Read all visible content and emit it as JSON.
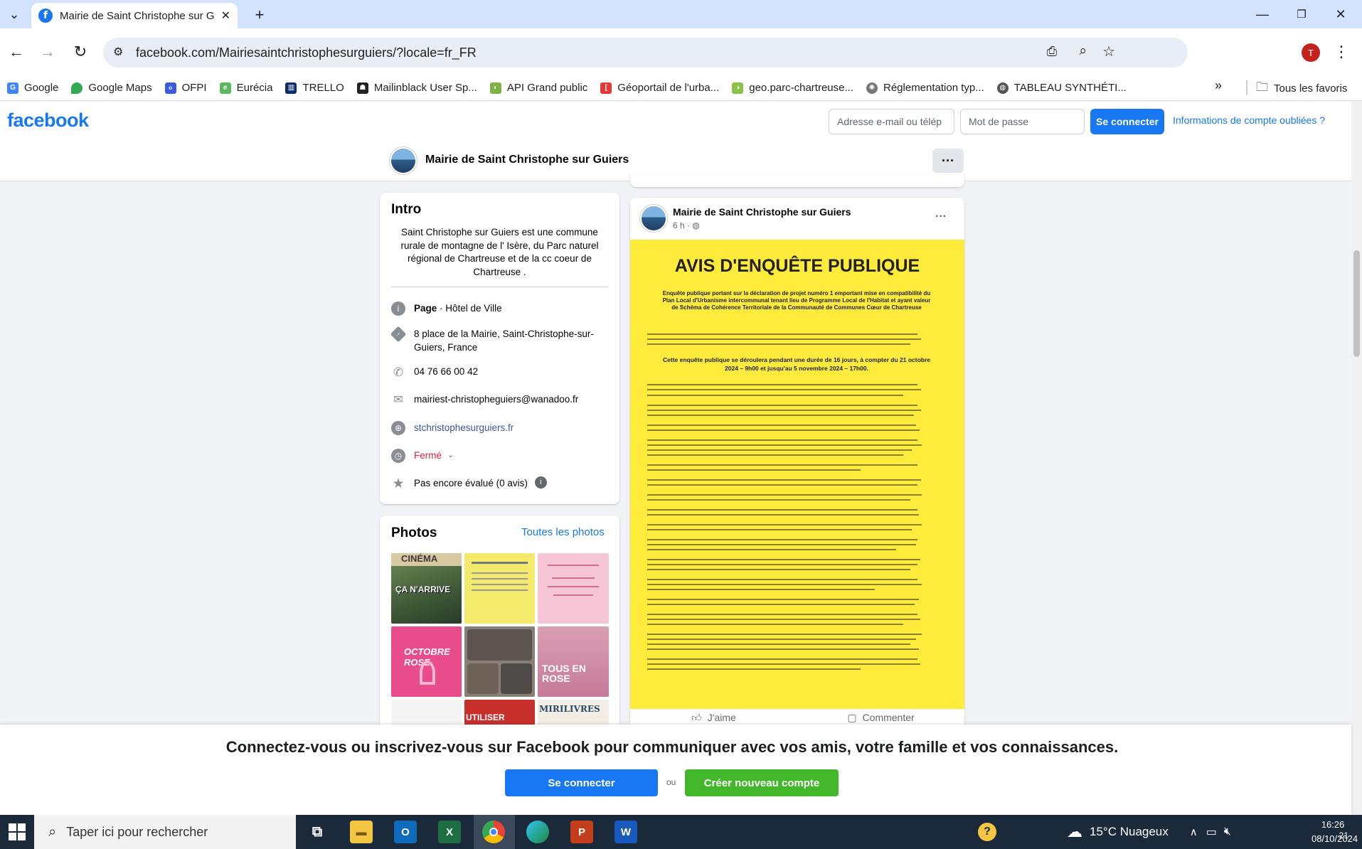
{
  "browser": {
    "tab_title": "Mairie de Saint Christophe sur G",
    "url": "facebook.com/Mairiesaintchristophesurguiers/?locale=fr_FR",
    "profile_initial": "T",
    "bookmarks": [
      "Google",
      "Google Maps",
      "OFPI",
      "Eurécia",
      "TRELLO",
      "Mailinblack User Sp...",
      "API Grand public",
      "Géoportail de l'urba...",
      "geo.parc-chartreuse...",
      "Réglementation typ...",
      "TABLEAU SYNTHÉTI..."
    ],
    "all_bookmarks": "Tous les favoris",
    "more": "»"
  },
  "fb_header": {
    "logo": "facebook",
    "email_placeholder": "Adresse e-mail ou télép",
    "password_placeholder": "Mot de passe",
    "login_label": "Se connecter",
    "forgot_label": "Informations de compte oubliées ?"
  },
  "page": {
    "name": "Mairie de Saint Christophe sur Guiers",
    "more": "···"
  },
  "intro": {
    "title": "Intro",
    "text": "Saint Christophe sur Guiers est une commune rurale de montagne de l' Isère, du Parc naturel régional de Chartreuse et de la cc coeur de Chartreuse .",
    "page_label": "Page",
    "page_category": " · Hôtel de Ville",
    "address": "8 place de la Mairie, Saint-Christophe-sur-Guiers, France",
    "phone": "04 76 66 00 42",
    "email": "mairiest-christopheguiers@wanadoo.fr",
    "website": "stchristophesurguiers.fr",
    "hours": "Fermé",
    "rating": "Pas encore évalué (0 avis)"
  },
  "photos": {
    "title": "Photos",
    "all_label": "Toutes les photos",
    "captions": [
      "CINÉMA",
      "ÇA N'ARRIVE",
      "OCTOBRE ROSE",
      "TOUS EN ROSE",
      "UTILISER",
      "MIRILIVRES"
    ]
  },
  "post": {
    "author": "Mairie de Saint Christophe sur Guiers",
    "time": "6 h ·",
    "more": "···",
    "poster_title": "AVIS D'ENQUÊTE PUBLIQUE",
    "poster_subtitle": "Enquête publique portant sur la déclaration de projet numéro 1 emportant mise en compatibilité du Plan Local d'Urbanisme intercommunal tenant lieu de Programme Local de l'Habitat et ayant valeur de Schéma de Cohérence Territoriale de la Communauté de Communes Cœur de Chartreuse",
    "poster_duration": "Cette enquête publique se déroulera pendant une durée de 16 jours, à compter du 21 octobre 2024 – 9h00 et jusqu'au 5 novembre 2024 – 17h00.",
    "like": "J'aime",
    "comment": "Commenter"
  },
  "overlay": {
    "text": "Connectez-vous ou inscrivez-vous sur Facebook pour communiquer avec vos amis, votre famille et vos connaissances.",
    "login": "Se connecter",
    "or": "ou",
    "create": "Créer nouveau compte"
  },
  "taskbar": {
    "search_placeholder": "Taper ici pour rechercher",
    "weather": "15°C  Nuageux",
    "time": "16:26",
    "date": "08/10/2024",
    "notifications": "21"
  }
}
